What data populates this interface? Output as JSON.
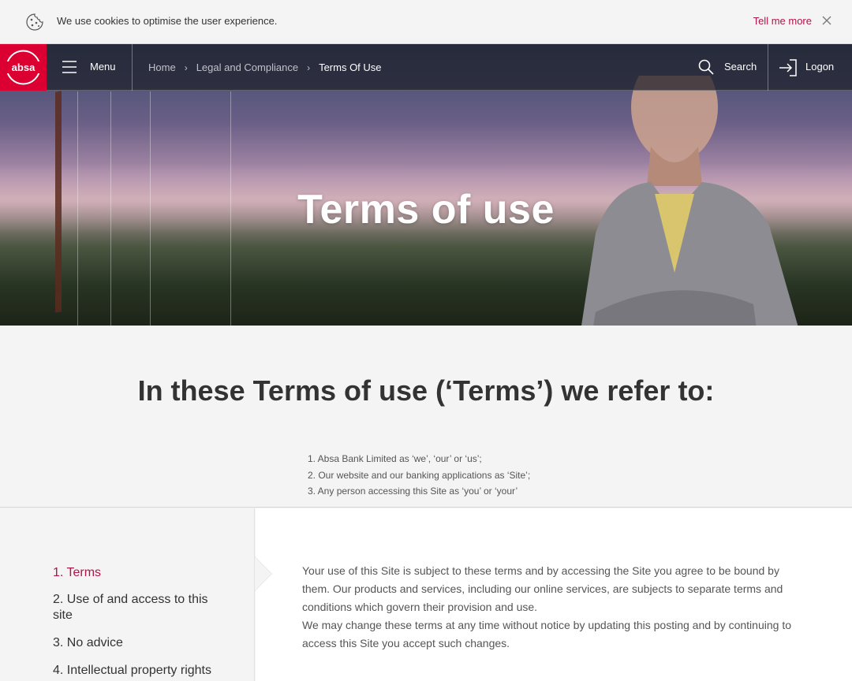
{
  "cookie": {
    "message": "We use cookies to optimise the user experience.",
    "tell_more": "Tell me more",
    "icon": "cookie-icon"
  },
  "nav": {
    "logo_text": "absa",
    "menu_label": "Menu",
    "breadcrumb": [
      "Home",
      "Legal and Compliance",
      "Terms Of Use"
    ],
    "search_label": "Search",
    "logon_label": "Logon"
  },
  "hero": {
    "title": "Terms of use"
  },
  "intro": {
    "heading": "In these Terms of use (‘Terms’) we refer to:",
    "items": [
      "1. Absa Bank Limited as ‘we’, ‘our’ or ‘us’;",
      "2. Our website and our banking applications as ‘Site’;",
      "3. Any person accessing this Site as ‘you’ or ‘your’"
    ]
  },
  "sidebar": {
    "items": [
      {
        "label": "1. Terms",
        "active": true
      },
      {
        "label": "2. Use of and access to this site",
        "active": false
      },
      {
        "label": "3. No advice",
        "active": false
      },
      {
        "label": "4. Intellectual property rights",
        "active": false
      }
    ]
  },
  "content": {
    "paragraphs": [
      "Your use of this Site is subject to these terms and by accessing the Site you agree to be bound by them. Our products and services, including our online services, are subjects to separate terms and conditions which govern their provision and use.",
      "We may change these terms at any time without notice by updating this posting and by continuing to access this Site you accept such changes."
    ]
  },
  "colors": {
    "brand_red": "#dc0032",
    "accent": "#af144b"
  }
}
